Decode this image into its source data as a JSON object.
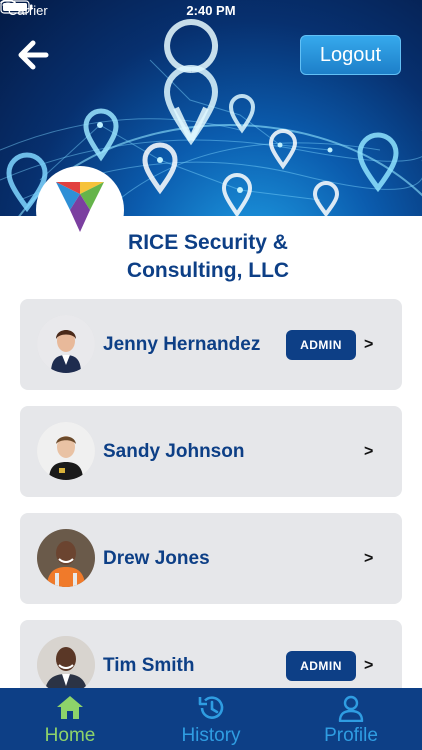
{
  "status_bar": {
    "carrier": "Carrier",
    "time": "2:40 PM"
  },
  "header": {
    "logout_label": "Logout"
  },
  "company": {
    "name_line1": "RICE Security &",
    "name_line2": "Consulting, LLC"
  },
  "members": [
    {
      "name": "Jenny Hernandez",
      "badge": "ADMIN",
      "chevron": ">"
    },
    {
      "name": "Sandy Johnson",
      "badge": "",
      "chevron": ">"
    },
    {
      "name": "Drew Jones",
      "badge": "",
      "chevron": ">"
    },
    {
      "name": "Tim Smith",
      "badge": "ADMIN",
      "chevron": ">"
    }
  ],
  "tabs": [
    {
      "label": "Home",
      "icon": "home-icon",
      "active": true
    },
    {
      "label": "History",
      "icon": "history-icon",
      "active": false
    },
    {
      "label": "Profile",
      "icon": "profile-icon",
      "active": false
    }
  ],
  "colors": {
    "brand_navy": "#0d3f86",
    "accent_blue": "#2f9de2",
    "active_green": "#8ed36a",
    "card_bg": "#e6e7ea"
  }
}
